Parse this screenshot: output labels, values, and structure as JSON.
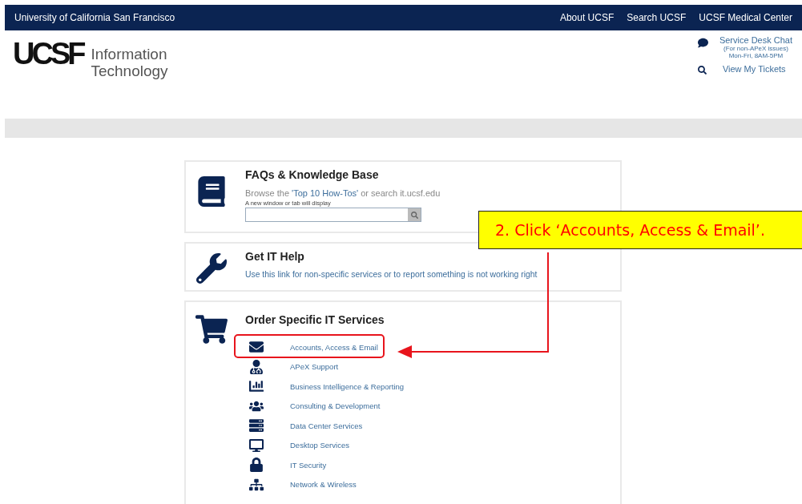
{
  "top_bar": {
    "title": "University of California San Francisco",
    "links": [
      "About UCSF",
      "Search UCSF",
      "UCSF Medical Center"
    ]
  },
  "header": {
    "logo": "UCSF",
    "logo_subtitle": [
      "Information",
      "Technology"
    ],
    "chat": {
      "label": "Service Desk Chat",
      "note": "(For non-APeX issues)",
      "hours": "Mon-Fri, 8AM-5PM"
    },
    "tickets": "View My Tickets"
  },
  "faq": {
    "title": "FAQs & Knowledge Base",
    "text_before": "Browse the ",
    "link": "'Top 10 How-Tos'",
    "text_after": " or search it.ucsf.edu",
    "hint": "A new window or tab will display"
  },
  "help": {
    "title": "Get IT Help",
    "link": "Use this link for non-specific services or to report something is not working right"
  },
  "order": {
    "title": "Order Specific IT Services",
    "services": [
      {
        "label": "Accounts, Access & Email",
        "highlighted": true
      },
      {
        "label": "APeX Support",
        "highlighted": false
      },
      {
        "label": "Business Intelligence & Reporting",
        "highlighted": false
      },
      {
        "label": "Consulting & Development",
        "highlighted": false
      },
      {
        "label": "Data Center Services",
        "highlighted": false
      },
      {
        "label": "Desktop Services",
        "highlighted": false
      },
      {
        "label": "IT Security",
        "highlighted": false
      },
      {
        "label": "Network & Wireless",
        "highlighted": false
      }
    ]
  },
  "callout": {
    "text": "2. Click ‘Accounts, Access & Email’."
  }
}
